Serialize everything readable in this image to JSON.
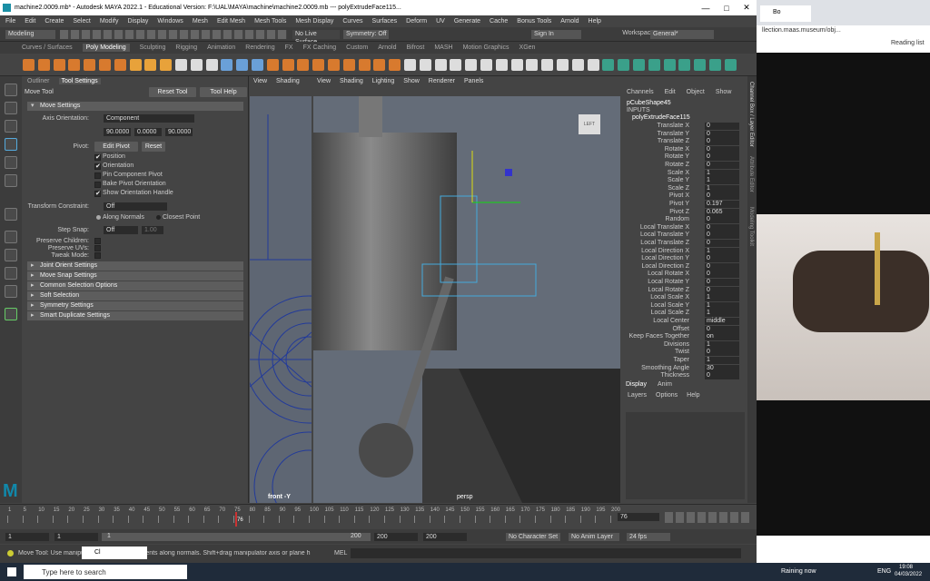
{
  "window": {
    "title": "machine2.0009.mb* - Autodesk MAYA 2022.1 - Educational Version: F:\\UAL\\MAYA\\machine\\machine2.0009.mb  ---  polyExtrudeFace115..."
  },
  "menu": [
    "File",
    "Edit",
    "Create",
    "Select",
    "Modify",
    "Display",
    "Windows",
    "Mesh",
    "Edit Mesh",
    "Mesh Tools",
    "Mesh Display",
    "Curves",
    "Surfaces",
    "Deform",
    "UV",
    "Generate",
    "Cache",
    "Bonus Tools",
    "Arnold",
    "Help"
  ],
  "workspace": {
    "label": "Workspace :",
    "value": "General*"
  },
  "status": {
    "mode": "Modeling",
    "live": "No Live Surface",
    "symmetry": "Symmetry: Off",
    "signin": "Sign In"
  },
  "shelf_tabs": [
    "Curves / Surfaces",
    "Poly Modeling",
    "Sculpting",
    "Rigging",
    "Animation",
    "Rendering",
    "FX",
    "FX Caching",
    "Custom",
    "Arnold",
    "Bifrost",
    "MASH",
    "Motion Graphics",
    "XGen"
  ],
  "panel": {
    "tabs": [
      "Outliner",
      "Tool Settings"
    ],
    "tool": "Move Tool",
    "reset": "Reset Tool",
    "help": "Tool Help",
    "move_settings": "Move Settings",
    "axis_label": "Axis Orientation:",
    "axis_value": "Component",
    "vals": [
      "90.0000",
      "0.0000",
      "90.0000"
    ],
    "pivot_label": "Pivot:",
    "edit_pivot": "Edit Pivot",
    "reset_pivot": "Reset",
    "checks": [
      "Position",
      "Orientation",
      "Pin Component Pivot",
      "Bake Pivot Orientation",
      "Show Orientation Handle"
    ],
    "tc_label": "Transform Constraint:",
    "tc_value": "Off",
    "along": "Along Normals",
    "closest": "Closest Point",
    "step_label": "Step Snap:",
    "step_value": "Off",
    "step_num": "1.00",
    "preserve": [
      "Preserve Children:",
      "Preserve UVs:",
      "Tweak Mode:"
    ],
    "sections": [
      "Joint Orient Settings",
      "Move Snap Settings",
      "Common Selection Options",
      "Soft Selection",
      "Symmetry Settings",
      "Smart Duplicate Settings"
    ]
  },
  "viewport_side": {
    "menu": [
      "View",
      "Shading"
    ],
    "label": "front -Y"
  },
  "viewport_persp": {
    "menu": [
      "View",
      "Shading",
      "Lighting",
      "Show",
      "Renderer",
      "Panels"
    ],
    "label": "persp",
    "cube": "LEFT"
  },
  "channel_box": {
    "menu": [
      "Channels",
      "Edit",
      "Object",
      "Show"
    ],
    "shape": "pCubeShape45",
    "inputs": "INPUTS",
    "node": "polyExtrudeFace115",
    "rows": [
      [
        "Translate X",
        "0"
      ],
      [
        "Translate Y",
        "0"
      ],
      [
        "Translate Z",
        "0"
      ],
      [
        "Rotate X",
        "0"
      ],
      [
        "Rotate Y",
        "0"
      ],
      [
        "Rotate Z",
        "0"
      ],
      [
        "Scale X",
        "1"
      ],
      [
        "Scale Y",
        "1"
      ],
      [
        "Scale Z",
        "1"
      ],
      [
        "Pivot X",
        "0"
      ],
      [
        "Pivot Y",
        "0.197"
      ],
      [
        "Pivot Z",
        "0.065"
      ],
      [
        "Random",
        "0"
      ],
      [
        "Local Translate X",
        "0"
      ],
      [
        "Local Translate Y",
        "0"
      ],
      [
        "Local Translate Z",
        "0"
      ],
      [
        "Local Direction X",
        "1"
      ],
      [
        "Local Direction Y",
        "0"
      ],
      [
        "Local Direction Z",
        "0"
      ],
      [
        "Local Rotate X",
        "0"
      ],
      [
        "Local Rotate Y",
        "0"
      ],
      [
        "Local Rotate Z",
        "0"
      ],
      [
        "Local Scale X",
        "1"
      ],
      [
        "Local Scale Y",
        "1"
      ],
      [
        "Local Scale Z",
        "1"
      ],
      [
        "Local Center",
        "middle"
      ],
      [
        "Offset",
        "0"
      ],
      [
        "Keep Faces Together",
        "on"
      ],
      [
        "Divisions",
        "1"
      ],
      [
        "Twist",
        "0"
      ],
      [
        "Taper",
        "1"
      ],
      [
        "Smoothing Angle",
        "30"
      ],
      [
        "Thickness",
        "0"
      ]
    ]
  },
  "side_tabs": [
    "Channel Box / Layer Editor",
    "Attribute Editor",
    "Modeling Toolkit"
  ],
  "layers": {
    "tabs": [
      "Display",
      "Anim"
    ],
    "menu": [
      "Layers",
      "Options",
      "Help"
    ]
  },
  "timeline": {
    "ticks": [
      "1",
      "5",
      "10",
      "15",
      "20",
      "25",
      "30",
      "35",
      "40",
      "45",
      "50",
      "55",
      "60",
      "65",
      "70",
      "75",
      "80",
      "85",
      "90",
      "95",
      "100",
      "105",
      "110",
      "115",
      "120",
      "125",
      "130",
      "135",
      "140",
      "145",
      "150",
      "155",
      "160",
      "165",
      "170",
      "175",
      "180",
      "185",
      "190",
      "195",
      "200"
    ],
    "current": "76",
    "frame_field": "76"
  },
  "range": {
    "start": "1",
    "start2": "1",
    "slider_start": "1",
    "slider_end": "200",
    "end": "200",
    "end2": "200",
    "charset": "No Character Set",
    "anim": "No Anim Layer",
    "fps": "24 fps"
  },
  "help": {
    "text": "Move Tool: Use manipulator to move components along normals. Shift+drag manipulator axis or plane h",
    "mel": "MEL",
    "cl": "Cl"
  },
  "browser": {
    "tab": "Bo",
    "url": "llection.maas.museum/obj...",
    "reading": "Reading list"
  },
  "taskbar": {
    "search": "Type here to search",
    "weather": "Raining now",
    "lang": "ENG",
    "time": "19:08",
    "date": "04/03/2022"
  }
}
